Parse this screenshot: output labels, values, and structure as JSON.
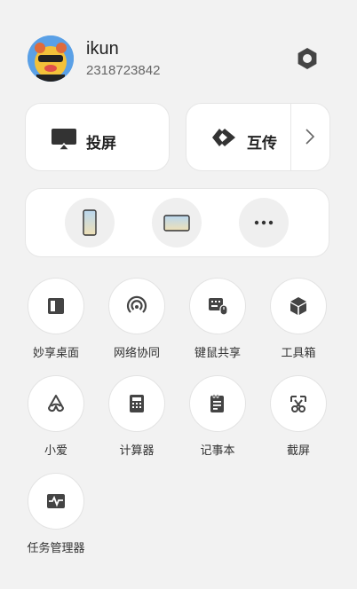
{
  "user": {
    "name": "ikun",
    "id": "2318723842"
  },
  "quick": {
    "cast_label": "投屏",
    "transfer_label": "互传"
  },
  "tools": [
    {
      "label": "妙享桌面",
      "icon": "desktop-share-icon"
    },
    {
      "label": "网络协同",
      "icon": "network-sync-icon"
    },
    {
      "label": "键鼠共享",
      "icon": "keyboard-mouse-share-icon"
    },
    {
      "label": "工具箱",
      "icon": "toolbox-icon"
    },
    {
      "label": "小爱",
      "icon": "xiaoai-icon"
    },
    {
      "label": "计算器",
      "icon": "calculator-icon"
    },
    {
      "label": "记事本",
      "icon": "notepad-icon"
    },
    {
      "label": "截屏",
      "icon": "screenshot-icon"
    },
    {
      "label": "任务管理器",
      "icon": "task-manager-icon"
    }
  ],
  "colors": {
    "icon": "#444444",
    "card_bg": "#ffffff",
    "panel_bg": "#f2f2f2",
    "avatar_bg": "#5aa0e6"
  }
}
